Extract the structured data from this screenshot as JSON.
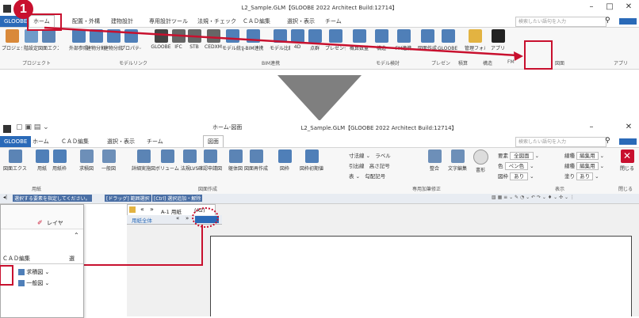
{
  "top_window": {
    "title": "L2_Sample.GLM【GLOOBE 2022 Architect Build:12714】",
    "tabs": [
      "GLOOBE",
      "ホーム",
      "配置・外構",
      "建物設計",
      "専用設計ツール",
      "法規・チェック",
      "ＣＡＤ編集",
      "選択・表示",
      "チーム"
    ],
    "search_placeholder": "検索したい語句を入力",
    "buttons": [
      {
        "label": "プロジェクト",
        "icon": "project-icon",
        "color": "#d9893a"
      },
      {
        "label": "階設定",
        "icon": "floor-settings-icon",
        "color": "#6f9bc9"
      },
      {
        "label": "図面エクスプローラー",
        "icon": "drawing-explorer-icon",
        "color": "#5b84b5"
      },
      {
        "label": "外部参照",
        "icon": "external-ref-icon",
        "color": "#4f7fb8"
      },
      {
        "label": "建物分割",
        "icon": "building-split-icon",
        "color": "#4f7fb8"
      },
      {
        "label": "建物分統",
        "icon": "building-merge-icon",
        "color": "#4f7fb8"
      },
      {
        "label": "プロパティリンク",
        "icon": "property-link-icon",
        "color": "#4f7fb8"
      },
      {
        "label": "GLOOBE",
        "icon": "gloobe-icon",
        "color": "#444444"
      },
      {
        "label": "IFC",
        "icon": "ifc-icon",
        "color": "#666666"
      },
      {
        "label": "STB",
        "icon": "stb-icon",
        "color": "#666666"
      },
      {
        "label": "CEDXM",
        "icon": "cedxm-icon",
        "color": "#666666"
      },
      {
        "label": "モデル統合",
        "icon": "model-integrate-icon",
        "color": "#4f7fb8"
      },
      {
        "label": "J-BIM連携",
        "icon": "jbim-icon",
        "color": "#4f7fb8"
      },
      {
        "label": "モデル比較",
        "icon": "model-compare-icon",
        "color": "#4f7fb8"
      },
      {
        "label": "4D",
        "icon": "4d-icon",
        "color": "#4f7fb8"
      },
      {
        "label": "点群",
        "icon": "point-cloud-icon",
        "color": "#4f7fb8"
      },
      {
        "label": "プレゼンデータ作成",
        "icon": "presentation-icon",
        "color": "#4f7fb8"
      },
      {
        "label": "概算数量",
        "icon": "estimate-icon",
        "color": "#4f7fb8"
      },
      {
        "label": "構造",
        "icon": "structure-icon",
        "color": "#4f7fb8"
      },
      {
        "label": "FM連携",
        "icon": "fm-icon",
        "color": "#4f7fb8"
      },
      {
        "label": "図面作成",
        "icon": "drawing-create-icon",
        "color": "#4f7fb8"
      },
      {
        "label": "GLOOBEシート",
        "icon": "gloobe-sheet-icon",
        "color": "#4f7fb8"
      },
      {
        "label": "管理フォルダ",
        "icon": "folder-icon",
        "color": "#e3b341"
      },
      {
        "label": "アプリ",
        "icon": "app-icon",
        "color": "#222222"
      }
    ],
    "groups": [
      "プロジェクト",
      "モデルリンク",
      "BIM連携",
      "モデル検討",
      "プレゼン",
      "積算",
      "構造",
      "FM",
      "図面",
      "アプリ"
    ]
  },
  "callout_number": "1",
  "bottom_window": {
    "title": "L2_Sample.GLM【GLOOBE 2022 Architect Build:12714】",
    "context_tab_header": "ホーム-図面",
    "tabs": [
      "GLOOBE",
      "ホーム",
      "ＣＡＤ編集",
      "選択・表示",
      "チーム",
      "図面"
    ],
    "search_placeholder": "検索したい語句を入力",
    "buttons": [
      {
        "label": "図面エクスプローラー",
        "icon": "drawing-explorer-icon"
      },
      {
        "label": "用紙",
        "icon": "paper-icon"
      },
      {
        "label": "用紙枠",
        "icon": "paper-frame-icon"
      },
      {
        "label": "求積図",
        "icon": "area-calc-icon"
      },
      {
        "label": "一般図",
        "icon": "general-drawing-icon"
      },
      {
        "label": "詳細実施図",
        "icon": "detail-drawing-icon"
      },
      {
        "label": "ボリューム解析",
        "icon": "volume-analysis-icon"
      },
      {
        "label": "法規LVS",
        "icon": "law-lvs-icon"
      },
      {
        "label": "確認申請図",
        "icon": "application-drawing-icon"
      },
      {
        "label": "躯体図",
        "icon": "frame-drawing-icon"
      },
      {
        "label": "図面再作成",
        "icon": "redraw-icon"
      },
      {
        "label": "図枠",
        "icon": "border-icon"
      },
      {
        "label": "図枠初期値",
        "icon": "border-default-icon"
      }
    ],
    "annotation_tools": [
      [
        "寸法線",
        "ラベル"
      ],
      [
        "引出線",
        "高さ記号"
      ],
      [
        "表",
        "勾配記号"
      ]
    ],
    "annotation_buttons": [
      "整合",
      "文字編集",
      "書形"
    ],
    "display_rows": [
      {
        "label": "要素",
        "value": "全図面"
      },
      {
        "label": "色",
        "value": "ペン色"
      },
      {
        "label": "図枠",
        "value": "あり"
      }
    ],
    "display_rows_right": [
      {
        "label": "線種",
        "value": "編集用"
      },
      {
        "label": "線種",
        "value": "編集用"
      },
      {
        "label": "塗り",
        "value": "あり"
      }
    ],
    "close_label": "閉じる",
    "groups": [
      "用紙",
      "図面作成",
      "専用加筆修正",
      "表示",
      "閉じる"
    ],
    "status_text": "選択する要素を指定してください。",
    "status_hints": [
      "[ドラッグ] 範囲選択",
      "[Ctrl] 選択追加・解除"
    ],
    "doc_tabs": [
      "A-1 用紙",
      "(A2)"
    ],
    "doc_tab_label": "用紙全体",
    "nav_arrows": [
      "«",
      "»"
    ]
  },
  "zoom_panel": {
    "tab_label": "ＣＡＤ編集",
    "tab_label_right": "選",
    "items": [
      "求積図",
      "一般図"
    ],
    "layer_label": "レイヤ",
    "chevron": "⌃"
  },
  "colors": {
    "accent_blue": "#2a6ab8",
    "highlight_red": "#c8102e",
    "arrow_gray": "#7f7f7f"
  }
}
